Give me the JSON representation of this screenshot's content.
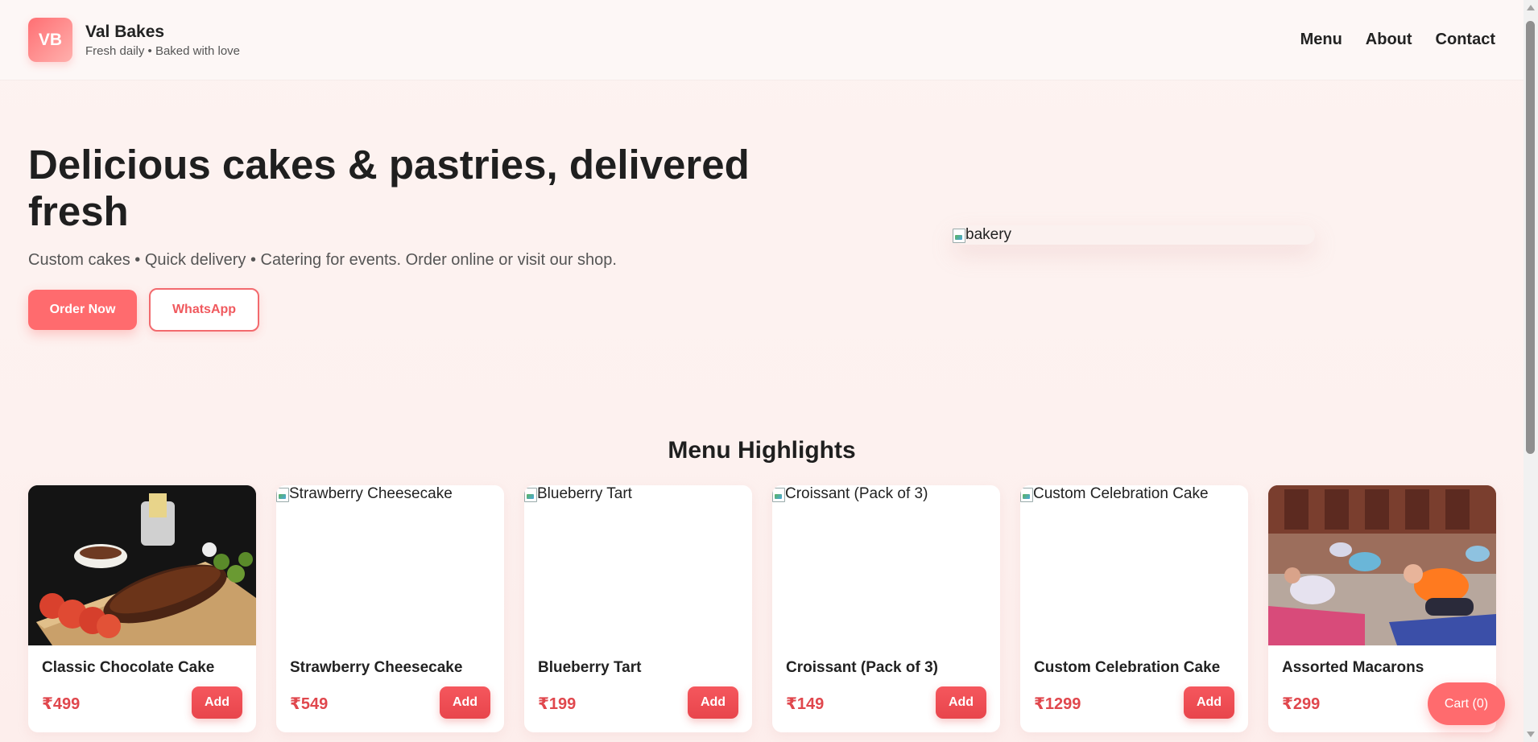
{
  "header": {
    "logo_text": "VB",
    "brand_name": "Val Bakes",
    "tagline": "Fresh daily • Baked with love",
    "nav": [
      {
        "label": "Menu"
      },
      {
        "label": "About"
      },
      {
        "label": "Contact"
      }
    ]
  },
  "hero": {
    "title": "Delicious cakes & pastries, delivered fresh",
    "subtitle": "Custom cakes • Quick delivery • Catering for events. Order online or visit our shop.",
    "primary_button": "Order Now",
    "secondary_button": "WhatsApp",
    "image_alt": "bakery"
  },
  "menu": {
    "title": "Menu Highlights",
    "add_label": "Add",
    "items": [
      {
        "name": "Classic Chocolate Cake",
        "price": "₹499",
        "image": "ribs-photo",
        "image_alt": ""
      },
      {
        "name": "Strawberry Cheesecake",
        "price": "₹549",
        "image": "broken",
        "image_alt": "Strawberry Cheesecake"
      },
      {
        "name": "Blueberry Tart",
        "price": "₹199",
        "image": "broken",
        "image_alt": "Blueberry Tart"
      },
      {
        "name": "Croissant (Pack of 3)",
        "price": "₹149",
        "image": "broken",
        "image_alt": "Croissant (Pack of 3)"
      },
      {
        "name": "Custom Celebration Cake",
        "price": "₹1299",
        "image": "broken",
        "image_alt": "Custom Celebration Cake"
      },
      {
        "name": "Assorted Macarons",
        "price": "₹299",
        "image": "yoga-photo",
        "image_alt": ""
      }
    ]
  },
  "cart": {
    "label": "Cart (0)"
  },
  "colors": {
    "accent": "#ff6b6e",
    "price": "#e0474d",
    "background": "#fdf3f1"
  }
}
